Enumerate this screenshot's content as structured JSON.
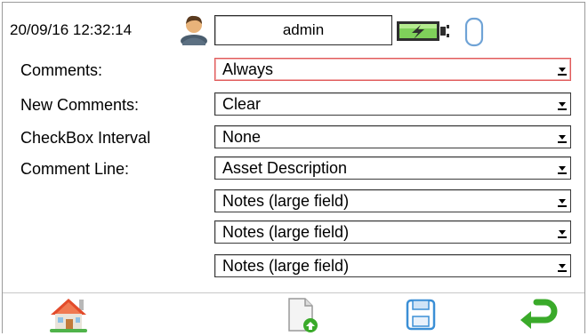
{
  "status_bar": {
    "datetime": "20/09/16 12:32:14",
    "user": "admin",
    "icons": [
      "user-icon",
      "battery-charging-icon",
      "usb-connection-icon"
    ]
  },
  "settings": [
    {
      "label": "Comments:",
      "value": "Always"
    },
    {
      "label": "New Comments:",
      "value": "Clear"
    },
    {
      "label": "CheckBox Interval",
      "value": "None"
    },
    {
      "label": "Comment Line:",
      "value": "Asset Description"
    },
    {
      "label": "",
      "value": "Notes (large field)"
    },
    {
      "label": "",
      "value": "Notes (large field)"
    },
    {
      "label": "",
      "value": "Notes (large field)"
    }
  ],
  "toolbar": {
    "buttons": [
      "home-icon",
      "new-document-icon",
      "save-icon",
      "back-icon"
    ]
  },
  "colors": {
    "focus_border": "#e05a5a",
    "home_roof": "#e34b2a",
    "green_accent": "#3aaa2a",
    "save_blue": "#3b8fd6"
  }
}
